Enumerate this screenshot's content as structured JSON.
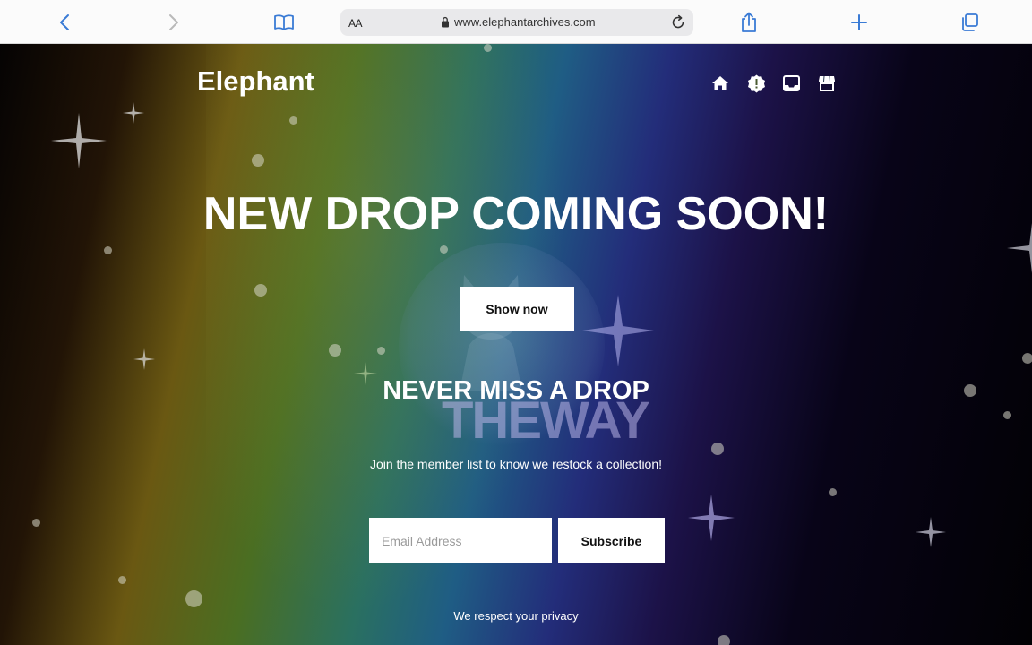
{
  "browser": {
    "address_aa": "AA",
    "url": "www.elephantarchives.com",
    "icons": [
      "back-icon",
      "forward-icon",
      "bookmarks-icon",
      "lock-icon",
      "reload-icon",
      "share-icon",
      "new-tab-icon",
      "tabs-icon"
    ]
  },
  "site": {
    "logo": "Elephant",
    "nav_icons": [
      "home-icon",
      "alert-badge-icon",
      "inbox-icon",
      "store-icon"
    ],
    "emblem_text": "THEWAY"
  },
  "hero": {
    "headline": "NEW DROP COMING SOON!",
    "show_button": "Show now"
  },
  "newsletter": {
    "title": "NEVER MISS A DROP",
    "description": "Join the member list to know we restock a collection!",
    "email_placeholder": "Email Address",
    "subscribe_button": "Subscribe",
    "privacy_note": "We respect your privacy"
  },
  "colors": {
    "toolbar_icon": "#3a7bd5",
    "toolbar_bg": "#fbfbfb",
    "address_bg": "#e9e9eb",
    "text": "#ffffff",
    "button_bg": "#ffffff"
  }
}
